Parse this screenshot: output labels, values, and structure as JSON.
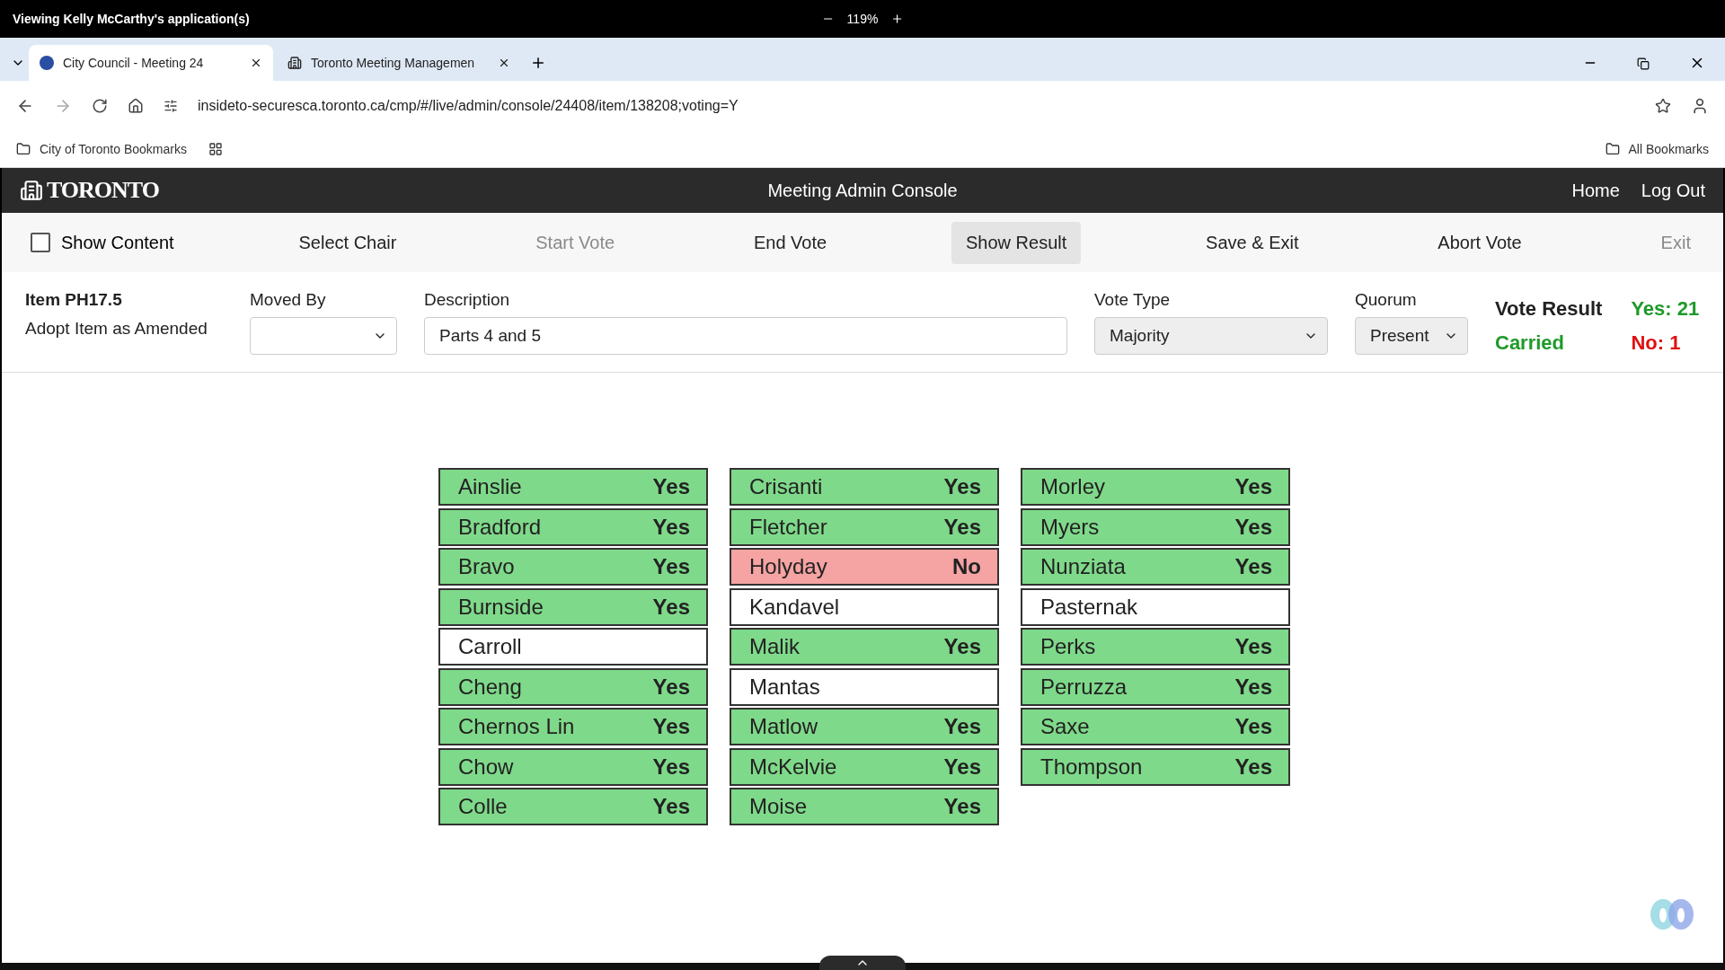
{
  "share_bar": {
    "title": "Viewing Kelly McCarthy's application(s)",
    "zoom": "119%"
  },
  "browser": {
    "tabs": [
      {
        "label": "City Council - Meeting 24",
        "selected": true
      },
      {
        "label": "Toronto Meeting Managemen",
        "selected": false
      }
    ],
    "url": "insideto-securesca.toronto.ca/cmp/#/live/admin/console/24408/item/138208;voting=Y",
    "bookmarks": {
      "folder": "City of Toronto Bookmarks",
      "all": "All Bookmarks"
    }
  },
  "header": {
    "logo": "TORONTO",
    "title": "Meeting Admin Console",
    "links": [
      "Home",
      "Log Out"
    ]
  },
  "toolbar": {
    "show_content": {
      "label": "Show Content",
      "checked": false
    },
    "actions": [
      {
        "label": "Select Chair",
        "disabled": false,
        "selected": false
      },
      {
        "label": "Start Vote",
        "disabled": true,
        "selected": false
      },
      {
        "label": "End Vote",
        "disabled": false,
        "selected": false
      },
      {
        "label": "Show Result",
        "disabled": false,
        "selected": true
      },
      {
        "label": "Save & Exit",
        "disabled": false,
        "selected": false
      },
      {
        "label": "Abort Vote",
        "disabled": false,
        "selected": false
      },
      {
        "label": "Exit",
        "disabled": true,
        "selected": false
      }
    ]
  },
  "item": {
    "number": "Item PH17.5",
    "title": "Adopt Item as Amended",
    "moved_by_label": "Moved By",
    "description_label": "Description",
    "description": "Parts 4 and 5",
    "vote_type_label": "Vote Type",
    "vote_type": "Majority",
    "quorum_label": "Quorum",
    "quorum": "Present",
    "result_label": "Vote Result",
    "result": "Carried",
    "yes": "Yes: 21",
    "no": "No: 1"
  },
  "members": [
    [
      {
        "name": "Ainslie",
        "vote": "Yes",
        "kind": "yes"
      },
      {
        "name": "Bradford",
        "vote": "Yes",
        "kind": "yes"
      },
      {
        "name": "Bravo",
        "vote": "Yes",
        "kind": "yes"
      },
      {
        "name": "Burnside",
        "vote": "Yes",
        "kind": "yes"
      },
      {
        "name": "Carroll",
        "kind": "none"
      },
      {
        "name": "Cheng",
        "vote": "Yes",
        "kind": "yes"
      },
      {
        "name": "Chernos Lin",
        "vote": "Yes",
        "kind": "yes"
      },
      {
        "name": "Chow",
        "vote": "Yes",
        "kind": "yes"
      },
      {
        "name": "Colle",
        "vote": "Yes",
        "kind": "yes"
      }
    ],
    [
      {
        "name": "Crisanti",
        "vote": "Yes",
        "kind": "yes"
      },
      {
        "name": "Fletcher",
        "vote": "Yes",
        "kind": "yes"
      },
      {
        "name": "Holyday",
        "vote": "No",
        "kind": "no"
      },
      {
        "name": "Kandavel",
        "kind": "none"
      },
      {
        "name": "Malik",
        "vote": "Yes",
        "kind": "yes"
      },
      {
        "name": "Mantas",
        "kind": "none"
      },
      {
        "name": "Matlow",
        "vote": "Yes",
        "kind": "yes"
      },
      {
        "name": "McKelvie",
        "vote": "Yes",
        "kind": "yes"
      },
      {
        "name": "Moise",
        "vote": "Yes",
        "kind": "yes"
      }
    ],
    [
      {
        "name": "Morley",
        "vote": "Yes",
        "kind": "yes"
      },
      {
        "name": "Myers",
        "vote": "Yes",
        "kind": "yes"
      },
      {
        "name": "Nunziata",
        "vote": "Yes",
        "kind": "yes"
      },
      {
        "name": "Pasternak",
        "kind": "none"
      },
      {
        "name": "Perks",
        "vote": "Yes",
        "kind": "yes"
      },
      {
        "name": "Perruzza",
        "vote": "Yes",
        "kind": "yes"
      },
      {
        "name": "Saxe",
        "vote": "Yes",
        "kind": "yes"
      },
      {
        "name": "Thompson",
        "vote": "Yes",
        "kind": "yes"
      }
    ]
  ]
}
